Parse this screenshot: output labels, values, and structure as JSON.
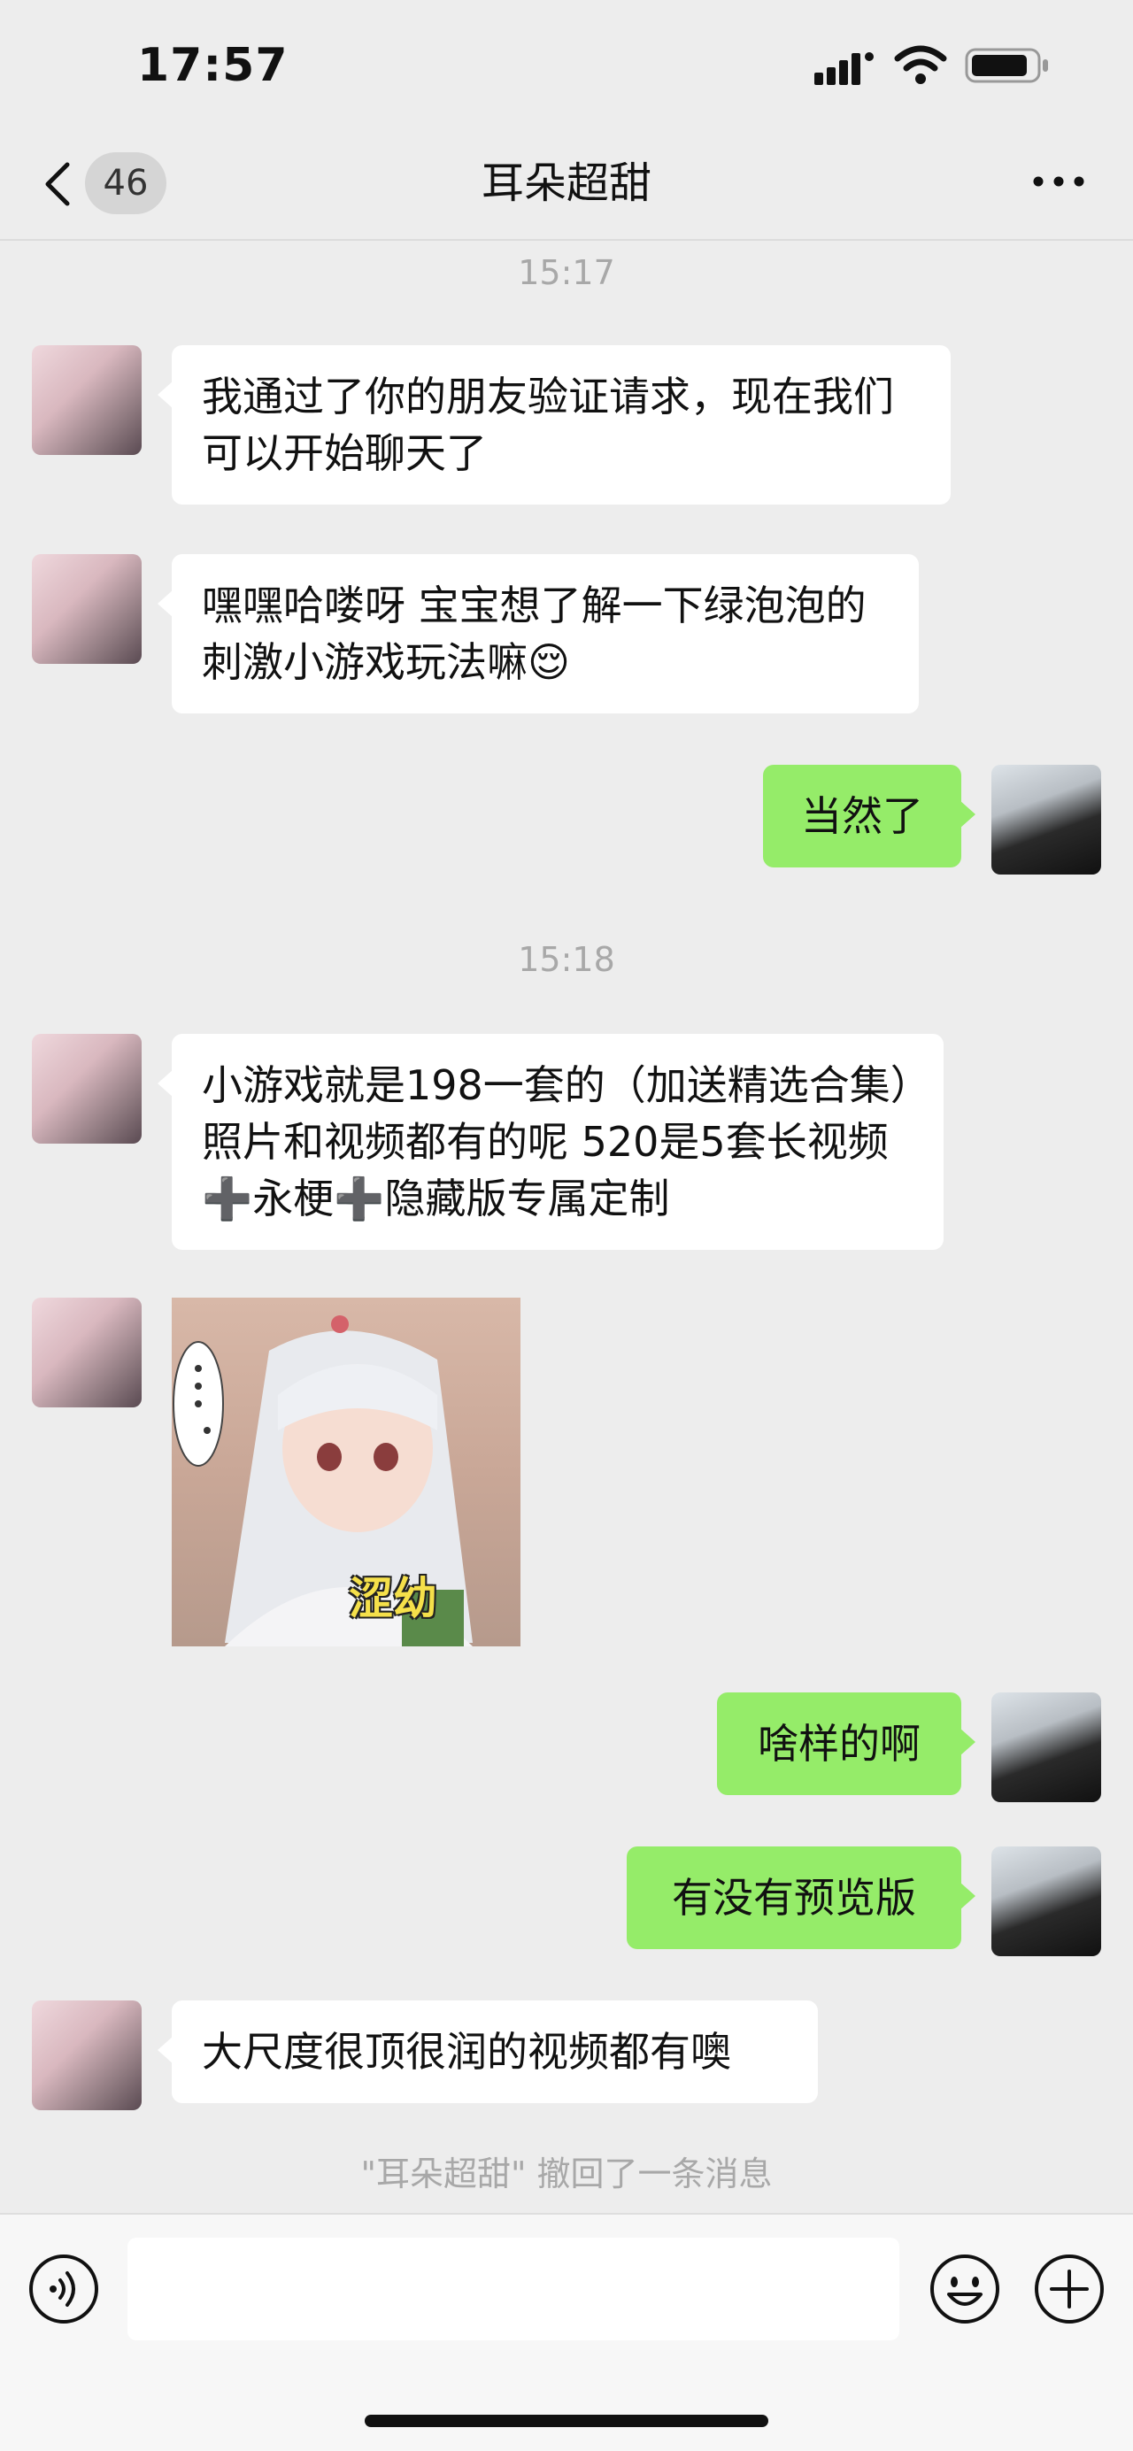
{
  "status_bar": {
    "time": "17:57"
  },
  "nav": {
    "unread_count": "46",
    "title": "耳朵超甜"
  },
  "messages": [
    {
      "type": "timestamp",
      "text": "15:17"
    },
    {
      "type": "text",
      "side": "in",
      "text": "我通过了你的朋友验证请求，现在我们可以开始聊天了"
    },
    {
      "type": "text",
      "side": "in",
      "text": "嘿嘿哈喽呀 宝宝想了解一下绿泡泡的刺激小游戏玩法嘛😌"
    },
    {
      "type": "text",
      "side": "out",
      "text": "当然了"
    },
    {
      "type": "timestamp",
      "text": "15:18"
    },
    {
      "type": "text",
      "side": "in",
      "text": "小游戏就是198一套的（加送精选合集）照片和视频都有的呢 520是5套长视频➕永梗➕隐藏版专属定制"
    },
    {
      "type": "sticker",
      "side": "in",
      "caption": "涩幼"
    },
    {
      "type": "text",
      "side": "out",
      "text": "啥样的啊"
    },
    {
      "type": "text",
      "side": "out",
      "text": "有没有预览版"
    },
    {
      "type": "text",
      "side": "in",
      "text": "大尺度很顶很润的视频都有噢"
    }
  ],
  "system_notice": "\"耳朵超甜\" 撤回了一条消息",
  "input_bar": {
    "placeholder": ""
  },
  "colors": {
    "background": "#ededed",
    "incoming_bubble": "#ffffff",
    "outgoing_bubble": "#95ec69"
  },
  "icons": [
    "back-icon",
    "more-icon",
    "voice-icon",
    "emoji-icon",
    "plus-icon",
    "signal-icon",
    "wifi-icon",
    "battery-icon"
  ]
}
